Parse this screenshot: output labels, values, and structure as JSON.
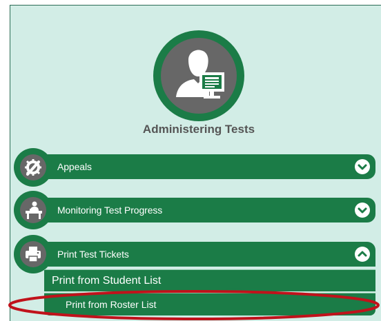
{
  "section": {
    "title": "Administering Tests",
    "icon": "test-administrator-computer-icon"
  },
  "accordion": [
    {
      "label": "Appeals",
      "icon": "tools-gear-icon",
      "state": "collapsed",
      "chevron": "chevron-down-icon"
    },
    {
      "label": "Monitoring Test Progress",
      "icon": "proctor-desk-icon",
      "state": "collapsed",
      "chevron": "chevron-down-icon"
    },
    {
      "label": "Print Test Tickets",
      "icon": "printer-icon",
      "state": "expanded",
      "chevron": "chevron-up-icon",
      "children": [
        {
          "label": "Print from Student List"
        },
        {
          "label": "Print from Roster List",
          "highlighted": true
        }
      ]
    }
  ],
  "colors": {
    "panel_bg": "#d2ede6",
    "brand_green": "#1b7c47",
    "icon_gray": "#676767",
    "title_gray": "#555555",
    "annotation_red": "#c0121b"
  }
}
